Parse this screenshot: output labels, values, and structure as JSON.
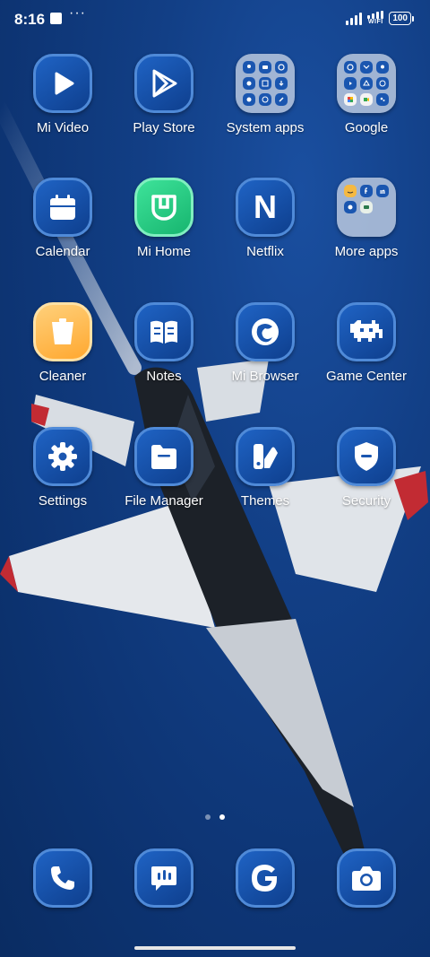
{
  "status_bar": {
    "time": "8:16",
    "network_label": "WIFI",
    "battery_level": "100"
  },
  "home_rows": [
    [
      "Mi Video",
      "Play Store",
      "System apps",
      "Google"
    ],
    [
      "Calendar",
      "Mi Home",
      "Netflix",
      "More apps"
    ],
    [
      "Cleaner",
      "Notes",
      "Mi Browser",
      "Game Center"
    ],
    [
      "Settings",
      "File Manager",
      "Themes",
      "Security"
    ]
  ],
  "apps": {
    "mi_video": "Mi Video",
    "play_store": "Play Store",
    "system_apps": "System apps",
    "google": "Google",
    "calendar": "Calendar",
    "mi_home": "Mi Home",
    "netflix": "Netflix",
    "more_apps": "More apps",
    "cleaner": "Cleaner",
    "notes": "Notes",
    "mi_browser": "Mi Browser",
    "game_center": "Game Center",
    "settings": "Settings",
    "file_manager": "File Manager",
    "themes": "Themes",
    "security": "Security"
  },
  "netflix_letter": "N",
  "dock": [
    "phone-icon",
    "messages-icon",
    "google-icon",
    "camera-icon"
  ],
  "page_indicator": {
    "pages": 2,
    "current": 2
  },
  "colors": {
    "icon_blue": "#1a56b0",
    "icon_border": "#4f8ad8",
    "mi_home_green": "#2bd38a",
    "cleaner_orange": "#ffb648",
    "wallpaper_blue": "#0d3473"
  }
}
